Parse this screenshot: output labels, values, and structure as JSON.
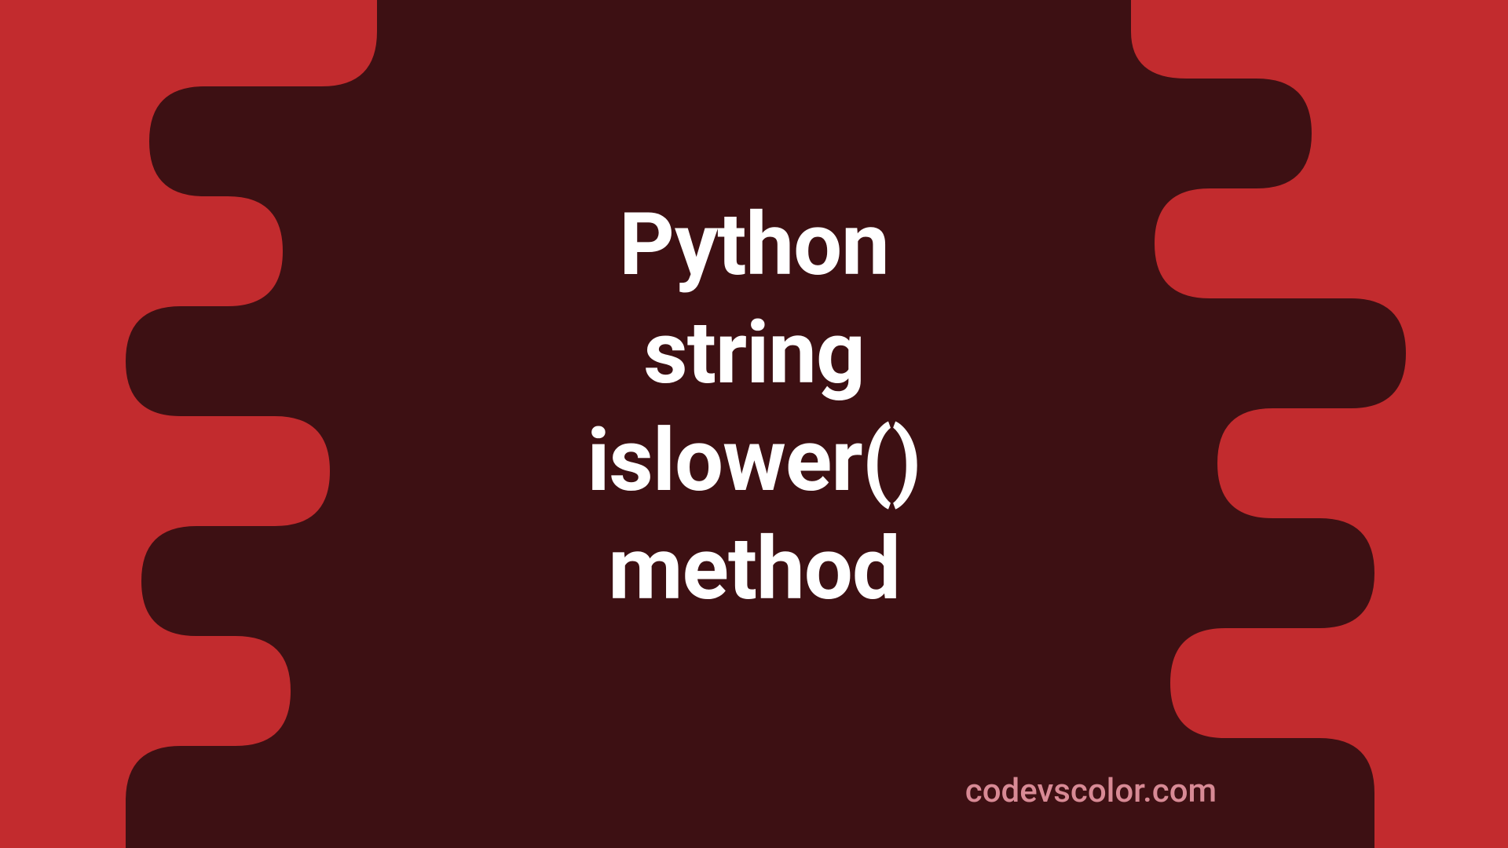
{
  "title": "Python\nstring\nislower()\nmethod",
  "watermark": "codevscolor.com",
  "colors": {
    "background": "#c22b2e",
    "panel": "#3d1013",
    "titleText": "#ffffff",
    "watermarkText": "#d88a95"
  }
}
